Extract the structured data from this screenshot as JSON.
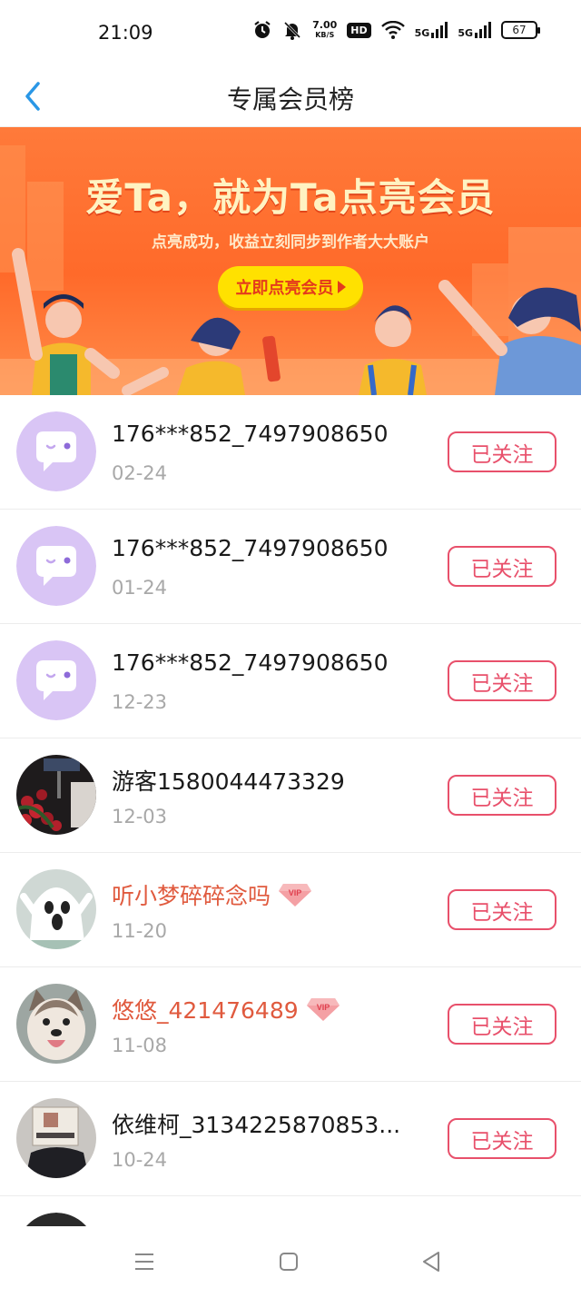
{
  "status_bar": {
    "time": "21:09",
    "speed_value": "7.00",
    "speed_unit": "KB/S",
    "hd_label": "HD",
    "net1": "5G",
    "net2": "5G",
    "battery": "67",
    "icons": [
      "alarm-icon",
      "mute-icon",
      "wifi-icon",
      "signal-icon",
      "battery-icon"
    ]
  },
  "header": {
    "title": "专属会员榜",
    "back_icon": "chevron-left-icon",
    "accent_color": "#2a97e6"
  },
  "banner": {
    "title": "爱Ta，就为Ta点亮会员",
    "subtitle": "点亮成功，收益立刻同步到作者大大账户",
    "cta_label": "立即点亮会员",
    "colors": {
      "background": "#ff6a2a",
      "cta": "#ffe100",
      "cta_text": "#e43a1c"
    }
  },
  "members": [
    {
      "name": "176***852_7497908650",
      "date": "02-24",
      "vip": false,
      "avatar": "default-chat-avatar",
      "follow_label": "已关注"
    },
    {
      "name": "176***852_7497908650",
      "date": "01-24",
      "vip": false,
      "avatar": "default-chat-avatar",
      "follow_label": "已关注"
    },
    {
      "name": "176***852_7497908650",
      "date": "12-23",
      "vip": false,
      "avatar": "default-chat-avatar",
      "follow_label": "已关注"
    },
    {
      "name": "游客1580044473329",
      "date": "12-03",
      "vip": false,
      "avatar": "roses-photo-avatar",
      "follow_label": "已关注"
    },
    {
      "name": "听小梦碎碎念吗",
      "date": "11-20",
      "vip": true,
      "avatar": "ghost-avatar",
      "follow_label": "已关注"
    },
    {
      "name": "悠悠_421476489",
      "date": "11-08",
      "vip": true,
      "avatar": "dog-photo-avatar",
      "follow_label": "已关注"
    },
    {
      "name": "依维柯_3134225870853...",
      "date": "10-24",
      "vip": false,
      "avatar": "box-photo-avatar",
      "follow_label": "已关注"
    }
  ],
  "vip_badge_label": "VIP",
  "colors": {
    "follow_border": "#e8506b",
    "vip_name": "#e05a3e",
    "date": "#a8a8a8",
    "default_avatar_bg": "#d9c5f5"
  },
  "nav_bar": {
    "icons": [
      "menu-icon",
      "home-icon",
      "back-icon"
    ]
  }
}
